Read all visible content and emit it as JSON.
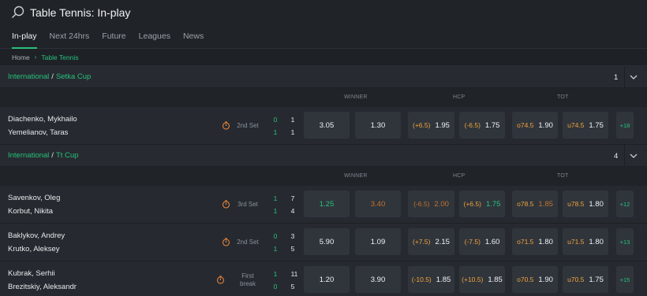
{
  "header": {
    "title": "Table Tennis: In-play",
    "search_icon": "search-icon"
  },
  "nav": {
    "tabs": [
      "In-play",
      "Next 24hrs",
      "Future",
      "Leagues",
      "News"
    ],
    "active": "In-play"
  },
  "breadcrumb": {
    "home": "Home",
    "current": "Table Tennis"
  },
  "colors": {
    "accent": "#27c07a",
    "handicap": "#f0a23a",
    "background": "#1e2227"
  },
  "market_headers": {
    "winner": "WINNER",
    "hcp": "HCP",
    "tot": "TOT"
  },
  "leagues": [
    {
      "category": "International",
      "name": "Setka Cup",
      "count": "1",
      "matches": [
        {
          "p1": "Diachenko, Mykhailo",
          "p2": "Yemelianov, Taras",
          "period": "2nd Set",
          "score1": [
            "0",
            "1"
          ],
          "score2": [
            "1",
            "1"
          ],
          "win1": "3.05",
          "win2": "1.30",
          "hcp1_line": "(+6.5)",
          "hcp1_odds": "1.95",
          "hcp2_line": "(-6.5)",
          "hcp2_odds": "1.75",
          "over_line": "o74.5",
          "over_odds": "1.90",
          "under_line": "u74.5",
          "under_odds": "1.75",
          "more": "+18"
        }
      ]
    },
    {
      "category": "International",
      "name": "Tt Cup",
      "count": "4",
      "matches": [
        {
          "p1": "Savenkov, Oleg",
          "p2": "Korbut, Nikita",
          "period": "3rd Set",
          "score1": [
            "1",
            "7"
          ],
          "score2": [
            "1",
            "4"
          ],
          "win1": "1.25",
          "win2": "3.40",
          "hcp1_line": "(-6.5)",
          "hcp1_odds": "2.00",
          "hcp2_line": "(+6.5)",
          "hcp2_odds": "1.75",
          "over_line": "o78.5",
          "over_odds": "1.85",
          "under_line": "u78.5",
          "under_odds": "1.80",
          "more": "+12"
        },
        {
          "p1": "Baklykov, Andrey",
          "p2": "Krutko, Aleksey",
          "period": "2nd Set",
          "score1": [
            "0",
            "3"
          ],
          "score2": [
            "1",
            "5"
          ],
          "win1": "5.90",
          "win2": "1.09",
          "hcp1_line": "(+7.5)",
          "hcp1_odds": "2.15",
          "hcp2_line": "(-7.5)",
          "hcp2_odds": "1.60",
          "over_line": "o71.5",
          "over_odds": "1.80",
          "under_line": "u71.5",
          "under_odds": "1.80",
          "more": "+13"
        },
        {
          "p1": "Kubrak, Serhii",
          "p2": "Brezitskiy, Aleksandr",
          "period_l1": "First",
          "period_l2": "break",
          "score1": [
            "1",
            "11"
          ],
          "score2": [
            "0",
            "5"
          ],
          "win1": "1.20",
          "win2": "3.90",
          "hcp1_line": "(-10.5)",
          "hcp1_odds": "1.85",
          "hcp2_line": "(+10.5)",
          "hcp2_odds": "1.85",
          "over_line": "o70.5",
          "over_odds": "1.90",
          "under_line": "u70.5",
          "under_odds": "1.75",
          "more": "+15"
        }
      ]
    }
  ]
}
